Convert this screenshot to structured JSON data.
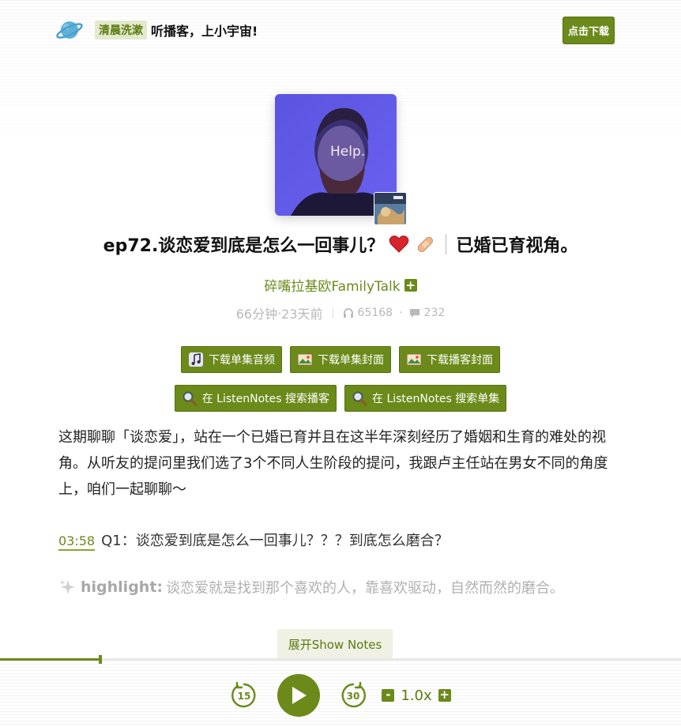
{
  "header": {
    "logo_icon": "planet-icon",
    "tag": "清晨洗漱",
    "slogan": "听播客，上小宇宙!",
    "download_button": "点击下载"
  },
  "cover": {
    "image_text": "Help.",
    "podcast_cover_icon": "podcast-thumbnail"
  },
  "episode": {
    "title_part1": "ep72.谈恋爱到底是怎么一回事儿？",
    "title_emojis": [
      "heart-icon",
      "bandage-icon"
    ],
    "title_part2": "已婚已育视角。",
    "podcast_name": "碎嘴拉基欧FamilyTalk",
    "subscribe_icon": "+",
    "duration": "66分钟",
    "dot": "·",
    "published": "23天前",
    "plays": "65168",
    "comments": "232",
    "sep_dot": "·"
  },
  "actions": {
    "row1": [
      {
        "label": "下载单集音频",
        "icon": "music-note-icon"
      },
      {
        "label": "下载单集封面",
        "icon": "picture-icon"
      },
      {
        "label": "下载播客封面",
        "icon": "picture-icon"
      }
    ],
    "row2": [
      {
        "label": "在 ListenNotes 搜索播客",
        "icon": "magnifier-icon"
      },
      {
        "label": "在 ListenNotes 搜索单集",
        "icon": "magnifier-icon"
      }
    ]
  },
  "show_notes": {
    "description": "这期聊聊「谈恋爱」，站在一个已婚已育并且在这半年深刻经历了婚姻和生育的难处的视角。从听友的提问里我们选了3个不同人生阶段的提问，我跟卢主任站在男女不同的角度上，咱们一起聊聊～",
    "timestamp": "03:58",
    "q1": "Q1：谈恋爱到底是怎么一回事儿？？？到底怎么磨合？",
    "highlight_label": "highlight:",
    "highlight_text": "谈恋爱就是找到那个喜欢的人，靠喜欢驱动，自然而然的磨合。",
    "expand_button": "展开Show Notes"
  },
  "player": {
    "progress": 0.147,
    "rewind": "15",
    "forward": "30",
    "speed": "1.0x",
    "minus": "-",
    "plus": "+"
  },
  "colors": {
    "accent": "#6b8a1a",
    "tag_bg": "#e3e9cc"
  }
}
